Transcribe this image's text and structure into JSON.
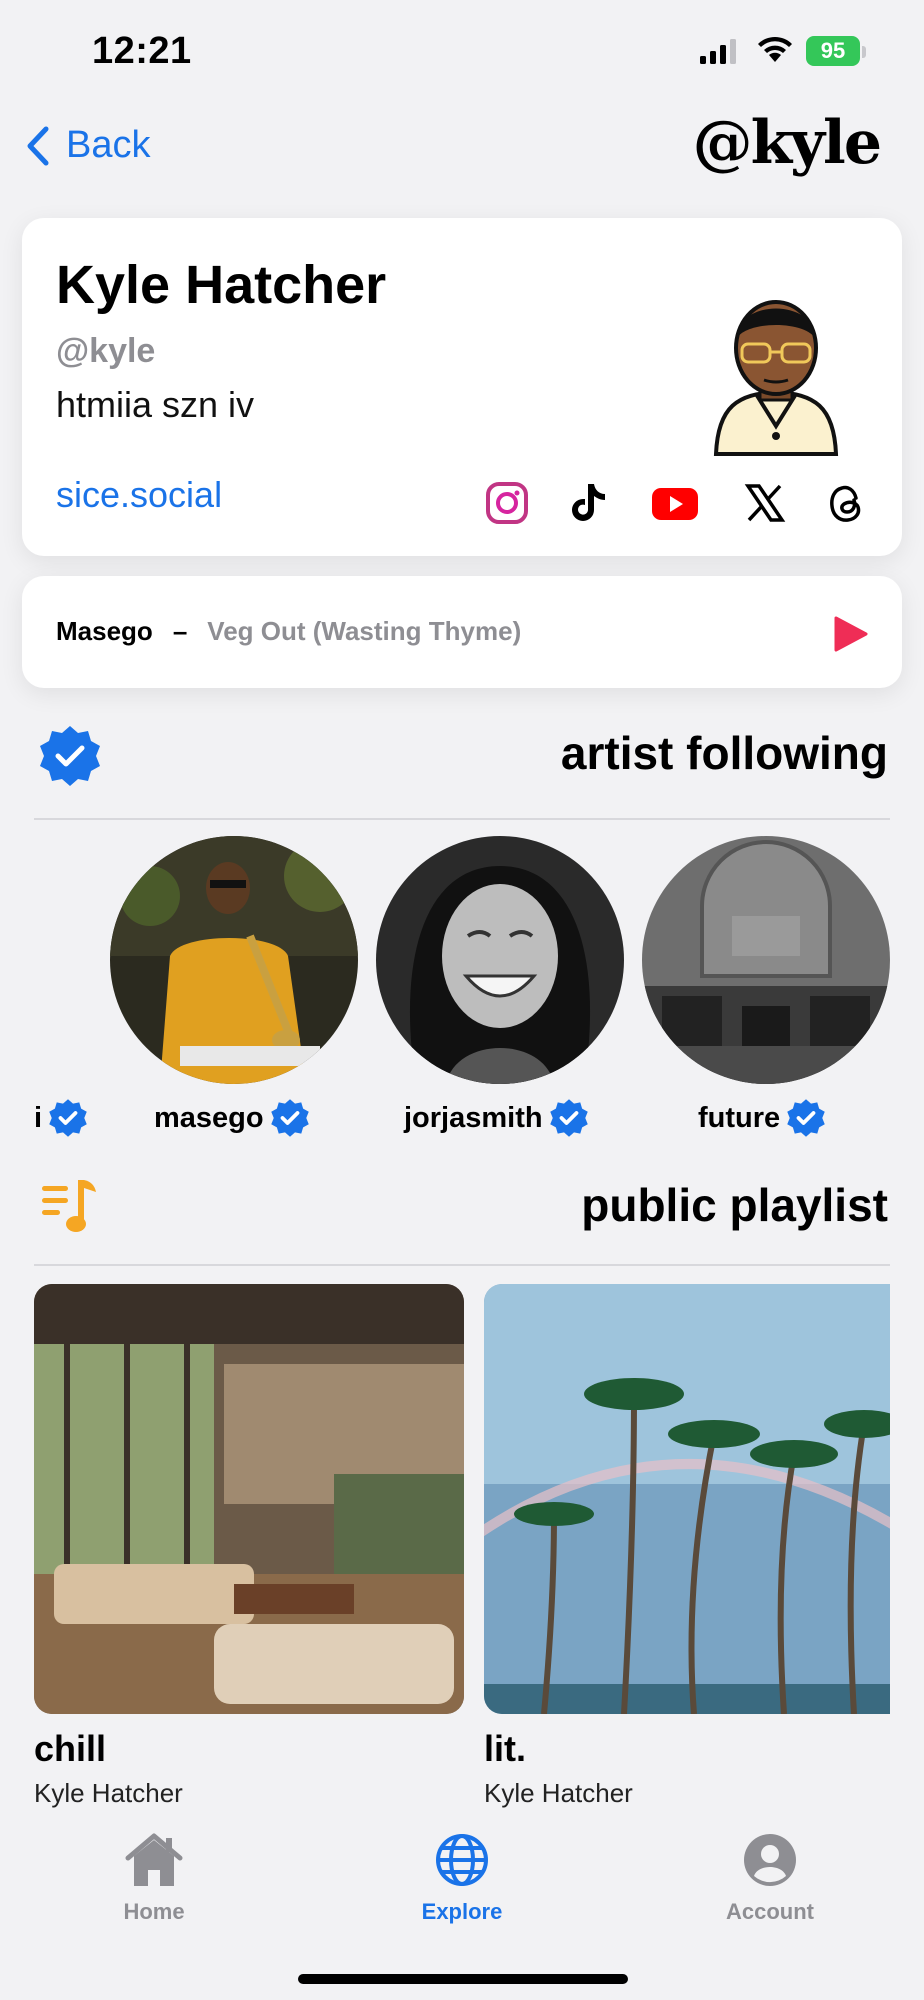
{
  "status_bar": {
    "time": "12:21",
    "battery": "95"
  },
  "nav": {
    "back_label": "Back",
    "logo_text": "@kyle"
  },
  "profile": {
    "name": "Kyle Hatcher",
    "handle": "@kyle",
    "bio": "htmiia szn iv",
    "website": "sice.social",
    "socials": [
      "instagram-icon",
      "tiktok-icon",
      "youtube-icon",
      "x-icon",
      "threads-icon"
    ]
  },
  "now_playing": {
    "artist": "Masego",
    "separator": "–",
    "song": "Veg Out (Wasting Thyme)"
  },
  "artist_section": {
    "title": "artist following"
  },
  "artists": [
    {
      "name": "i"
    },
    {
      "name": "masego"
    },
    {
      "name": "jorjasmith"
    },
    {
      "name": "future"
    }
  ],
  "playlist_section": {
    "title": "public playlist"
  },
  "playlists": [
    {
      "title": "chill",
      "owner": "Kyle Hatcher"
    },
    {
      "title": "lit.",
      "owner": "Kyle Hatcher"
    }
  ],
  "tabs": [
    {
      "label": "Home",
      "active": false
    },
    {
      "label": "Explore",
      "active": true
    },
    {
      "label": "Account",
      "active": false
    }
  ],
  "colors": {
    "accent": "#1a73e8",
    "play": "#ef2d56",
    "playlist_icon": "#f5a623",
    "inactive": "#8e8e93"
  }
}
